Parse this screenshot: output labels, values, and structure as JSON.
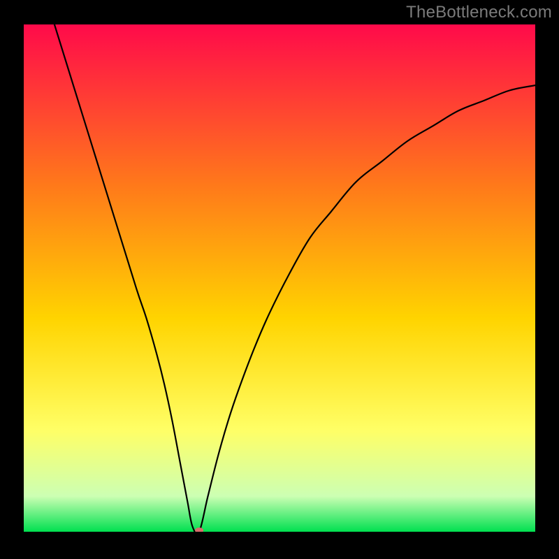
{
  "watermark": "TheBottleneck.com",
  "chart_data": {
    "type": "line",
    "title": "",
    "xlabel": "",
    "ylabel": "",
    "x_range": [
      0,
      100
    ],
    "y_range": [
      0,
      100
    ],
    "series": [
      {
        "name": "curve",
        "x": [
          6,
          10,
          14,
          18,
          22,
          24,
          26,
          27.5,
          29,
          30.5,
          32,
          33,
          34.3,
          36,
          38,
          40,
          42,
          45,
          48,
          52,
          56,
          60,
          65,
          70,
          75,
          80,
          85,
          90,
          95,
          100
        ],
        "y": [
          100,
          87,
          74,
          61,
          48,
          42,
          35,
          29,
          22,
          14,
          6,
          1,
          0,
          7,
          15,
          22,
          28,
          36,
          43,
          51,
          58,
          63,
          69,
          73,
          77,
          80,
          83,
          85,
          87,
          88
        ]
      }
    ],
    "marker": {
      "x": 34.3,
      "y": 0,
      "color": "#d96c6c"
    },
    "background_gradient": {
      "top": "#ff0a4a",
      "mid1": "#ff7a1a",
      "mid2": "#ffd400",
      "mid3": "#ffff66",
      "mid4": "#ccffb3",
      "bottom": "#00e050"
    },
    "frame_color": "#000000",
    "curve_color": "#000000"
  }
}
